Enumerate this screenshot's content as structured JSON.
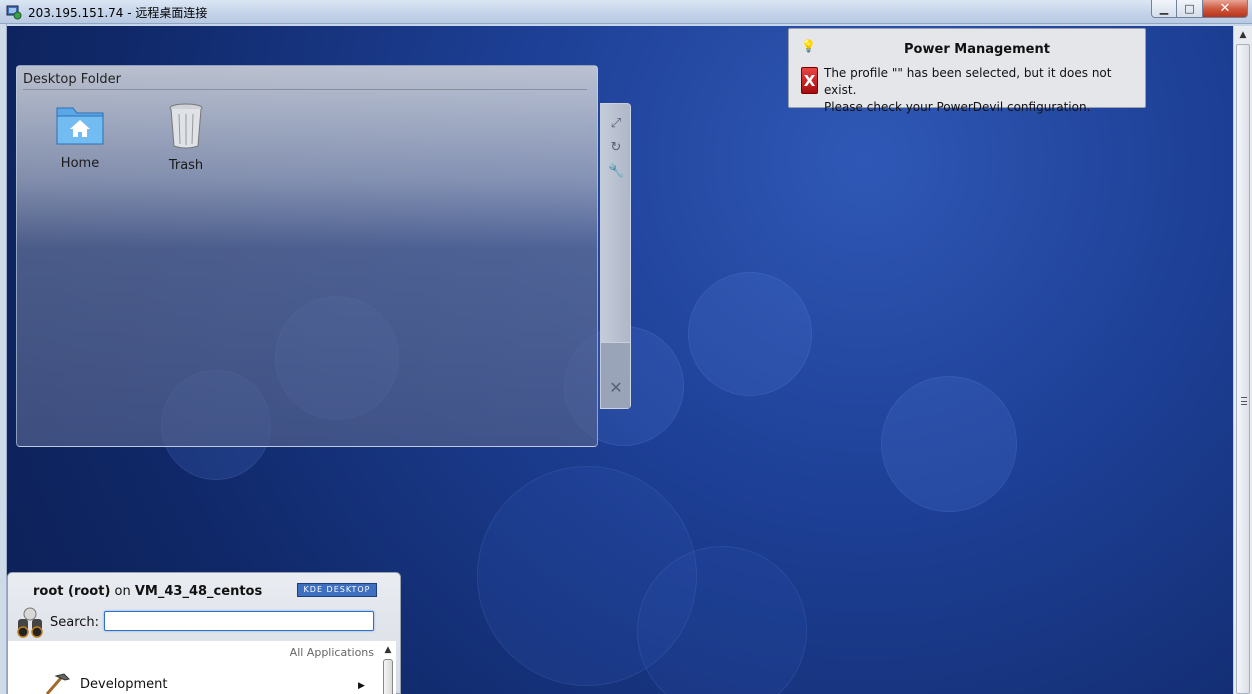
{
  "window": {
    "title": "203.195.151.74 - 远程桌面连接",
    "buttons": {
      "minimize": "▁",
      "maximize": "□",
      "close": "✕"
    }
  },
  "desktop_folder": {
    "title": "Desktop Folder",
    "items": [
      {
        "label": "Home",
        "icon": "home-folder-icon"
      },
      {
        "label": "Trash",
        "icon": "trash-icon"
      }
    ]
  },
  "widget_handle": {
    "icons": [
      "resize-icon",
      "rotate-icon",
      "settings-wrench-icon",
      "close-icon"
    ]
  },
  "notification": {
    "title": "Power Management",
    "line1": "The profile \"\" has been selected, but it does not exist.",
    "line2": "Please check your PowerDevil configuration."
  },
  "kickoff": {
    "user_name": "root (root)",
    "user_on": "on",
    "host": "VM_43_48_centos",
    "badge": "KDE DESKTOP",
    "search_label": "Search:",
    "search_value": "",
    "section_label": "All Applications",
    "first_item": "Development"
  },
  "colors": {
    "desktop_bg": "#1d3f95",
    "titlebar": "#c3d3e8",
    "close_button": "#cf5a41"
  }
}
